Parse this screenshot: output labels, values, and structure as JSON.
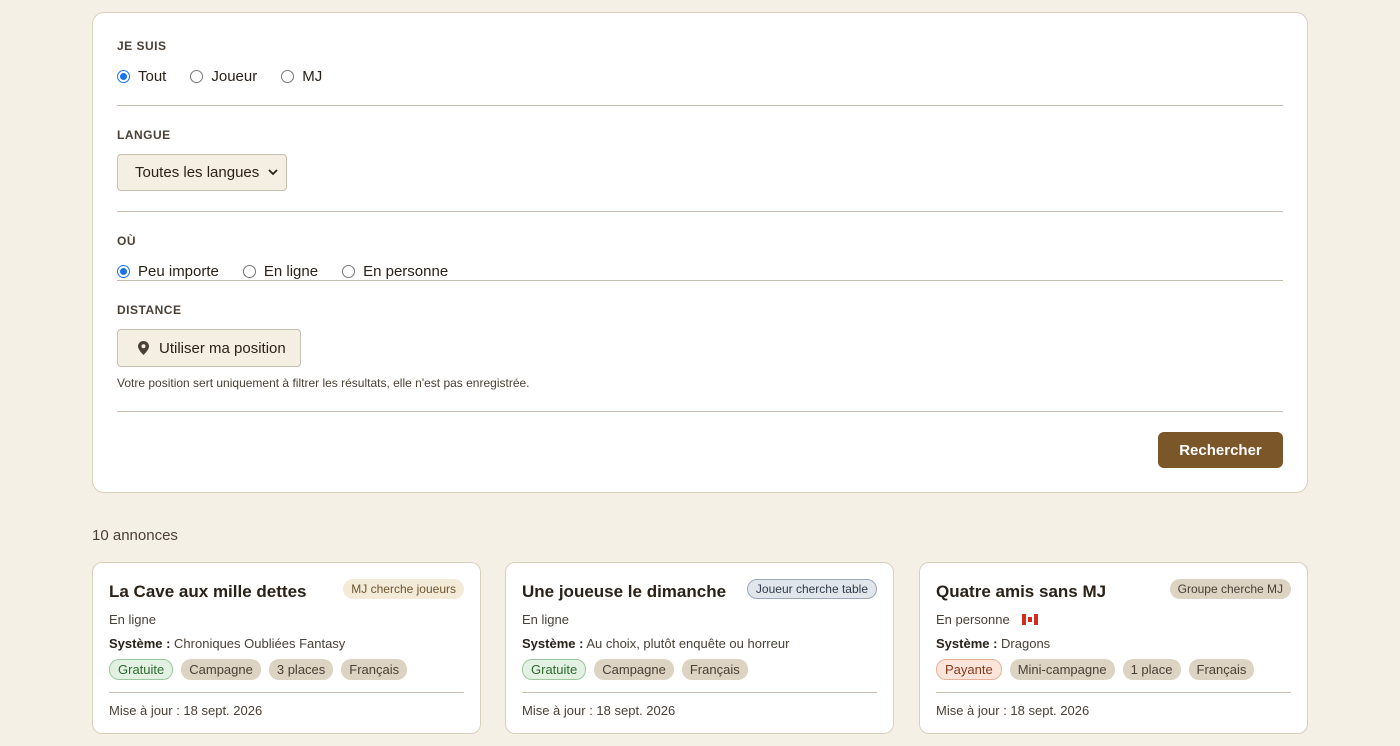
{
  "filters": {
    "role": {
      "label": "JE SUIS",
      "options": [
        "Tout",
        "Joueur",
        "MJ"
      ],
      "selected": "Tout"
    },
    "language": {
      "label": "LANGUE",
      "value": "Toutes les langues"
    },
    "where": {
      "label": "OÙ",
      "options": [
        "Peu importe",
        "En ligne",
        "En personne"
      ],
      "selected": "Peu importe"
    },
    "distance": {
      "label": "DISTANCE",
      "button_label": "Utiliser ma position",
      "note": "Votre position sert uniquement à filtrer les résultats, elle n'est pas enregistrée."
    },
    "search_label": "Rechercher"
  },
  "results": {
    "count": "10 annonces",
    "system_label": "Système :",
    "cards": [
      {
        "title": "La Cave aux mille dettes",
        "type": "MJ cherche joueurs",
        "place": "En ligne",
        "system": "Chroniques Oubliées Fantasy",
        "tags": [
          "Gratuite",
          "Campagne",
          "3 places",
          "Français"
        ],
        "updated": "Mise à jour : 18 sept. 2026"
      },
      {
        "title": "Une joueuse le dimanche",
        "type": "Joueur cherche table",
        "place": "En ligne",
        "system": "Au choix, plutôt enquête ou horreur",
        "tags": [
          "Gratuite",
          "Campagne",
          "Français"
        ],
        "updated": "Mise à jour : 18 sept. 2026"
      },
      {
        "title": "Quatre amis sans MJ",
        "type": "Groupe cherche MJ",
        "place": "En personne",
        "system": "Dragons",
        "tags": [
          "Payante",
          "Mini-campagne",
          "1 place",
          "Français"
        ],
        "updated": "Mise à jour : 18 sept. 2026"
      }
    ]
  },
  "icons": {
    "location": "map-pin-icon",
    "select": "chevron-down-icon",
    "flag": "canada-flag-icon"
  },
  "colors": {
    "background": "#f5f0e6",
    "accent": "#7a5628",
    "radio": "#1a73e8",
    "free_tag": "#e3f1e3",
    "paid_tag": "#fbe5da"
  }
}
